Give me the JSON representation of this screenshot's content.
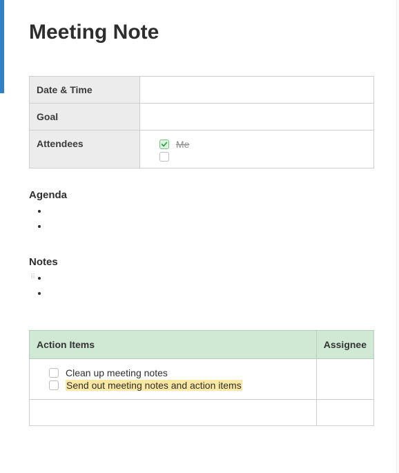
{
  "title": "Meeting Note",
  "meta": {
    "rows": [
      {
        "label": "Date & Time",
        "value": ""
      },
      {
        "label": "Goal",
        "value": ""
      }
    ],
    "attendees_label": "Attendees",
    "attendees": [
      {
        "name": "Me",
        "checked": true
      }
    ]
  },
  "sections": {
    "agenda": {
      "heading": "Agenda",
      "items": [
        "",
        ""
      ]
    },
    "notes": {
      "heading": "Notes",
      "items": [
        "",
        ""
      ]
    }
  },
  "action_table": {
    "headers": {
      "items": "Action Items",
      "assignee": "Assignee"
    },
    "rows": [
      {
        "text": "Clean up meeting notes",
        "highlighted": false,
        "checked": false,
        "assignee": ""
      },
      {
        "text": "Send out meeting notes and action items",
        "highlighted": true,
        "checked": false,
        "assignee": ""
      }
    ]
  },
  "colors": {
    "accent_bar": "#2f80c5",
    "header_grey": "#ececec",
    "action_header": "#cfe9d5",
    "highlight": "#fbe9a3",
    "check_green_bg": "#d8f4dd"
  }
}
